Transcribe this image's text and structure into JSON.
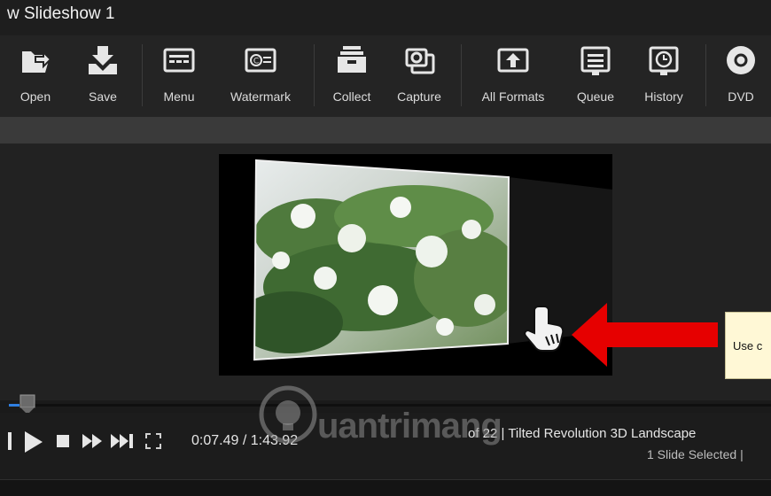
{
  "window": {
    "title": "w Slideshow 1"
  },
  "toolbar": [
    {
      "id": "open",
      "label": "Open",
      "icon": "open-folder-icon"
    },
    {
      "id": "save",
      "label": "Save",
      "icon": "save-tray-icon"
    },
    {
      "id": "menu",
      "label": "Menu",
      "icon": "menu-screen-icon"
    },
    {
      "id": "watermark",
      "label": "Watermark",
      "icon": "watermark-copyright-icon"
    },
    {
      "id": "collect",
      "label": "Collect",
      "icon": "collect-box-icon"
    },
    {
      "id": "capture",
      "label": "Capture",
      "icon": "capture-camera-icon"
    },
    {
      "id": "all-formats",
      "label": "All Formats",
      "icon": "export-upload-icon"
    },
    {
      "id": "queue",
      "label": "Queue",
      "icon": "queue-list-icon"
    },
    {
      "id": "history",
      "label": "History",
      "icon": "history-clock-icon"
    },
    {
      "id": "dvd",
      "label": "DVD",
      "icon": "dvd-disc-icon"
    }
  ],
  "tooltip": {
    "text": "Use c"
  },
  "playback": {
    "time": "0:07.49 / 1:43.92",
    "slide_info": "of 22  |  Tilted Revolution 3D Landscape",
    "selection": "1 Slide Selected  |",
    "progress": 0.072
  },
  "watermark": {
    "text": "uantrimang",
    "icon": "lightbulb-icon"
  },
  "colors": {
    "accent": "#2f7fe0",
    "arrow": "#e60000",
    "tooltip_bg": "#fff8d6"
  }
}
